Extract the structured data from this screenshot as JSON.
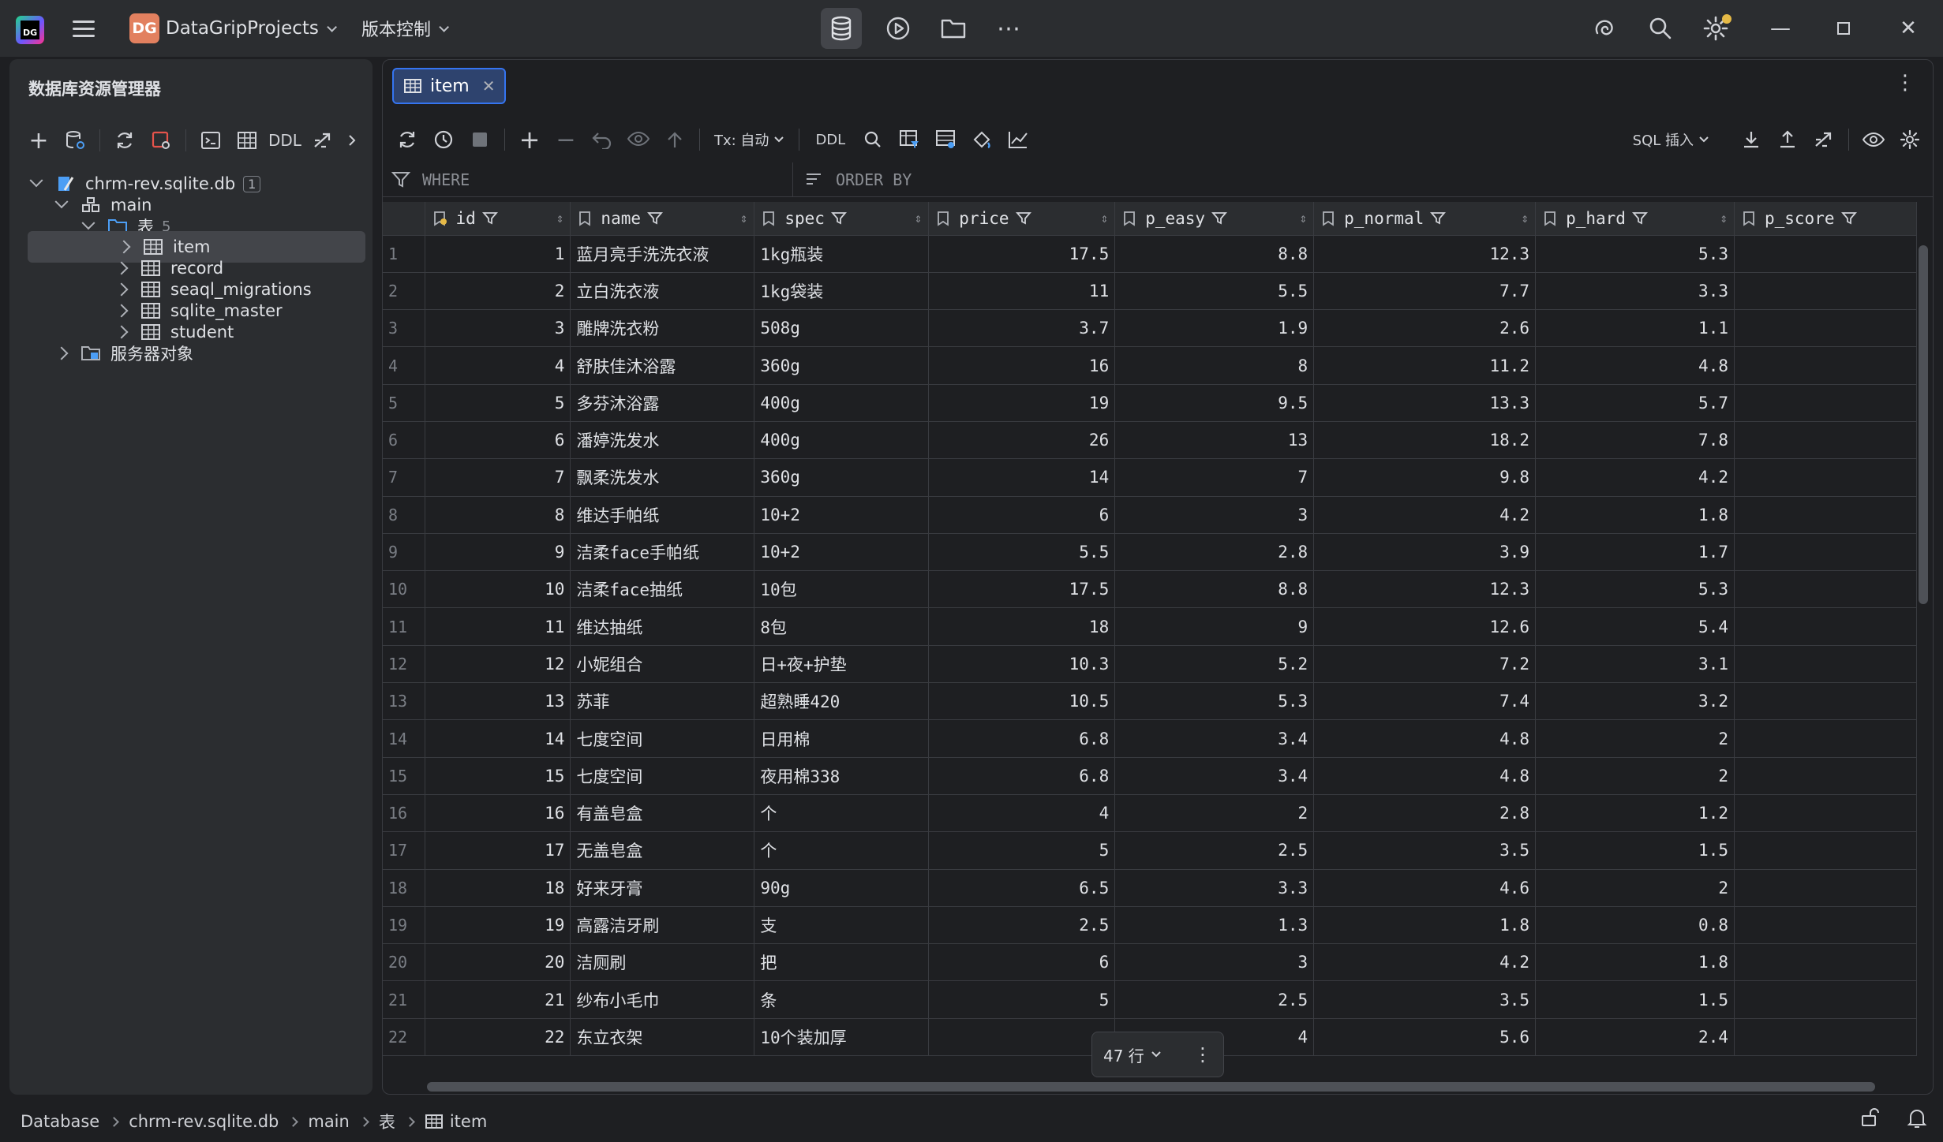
{
  "titlebar": {
    "project_badge": "DG",
    "project_name": "DataGripProjects",
    "vcs_label": "版本控制",
    "logo_text": "DG"
  },
  "left_panel": {
    "title": "数据库资源管理器",
    "toolbar_ddl": "DDL",
    "tree": {
      "db_name": "chrm-rev.sqlite.db",
      "db_badge": "1",
      "schema": "main",
      "tables_folder": "表",
      "tables_count": "5",
      "tables": [
        "item",
        "record",
        "seaql_migrations",
        "sqlite_master",
        "student"
      ],
      "server_objects": "服务器对象"
    }
  },
  "editor": {
    "tab_label": "item",
    "toolbar": {
      "tx_label": "Tx: 自动",
      "ddl_label": "DDL",
      "sql_insert_label": "SQL 插入"
    },
    "filter": {
      "where_label": "WHERE",
      "order_by_label": "ORDER BY"
    },
    "columns": [
      "id",
      "name",
      "spec",
      "price",
      "p_easy",
      "p_normal",
      "p_hard",
      "p_score"
    ],
    "rows": [
      [
        "1",
        "1",
        "蓝月亮手洗洗衣液",
        "1kg瓶装",
        "17.5",
        "8.8",
        "12.3",
        "5.3",
        ""
      ],
      [
        "2",
        "2",
        "立白洗衣液",
        "1kg袋装",
        "11",
        "5.5",
        "7.7",
        "3.3",
        ""
      ],
      [
        "3",
        "3",
        "雕牌洗衣粉",
        "508g",
        "3.7",
        "1.9",
        "2.6",
        "1.1",
        ""
      ],
      [
        "4",
        "4",
        "舒肤佳沐浴露",
        "360g",
        "16",
        "8",
        "11.2",
        "4.8",
        ""
      ],
      [
        "5",
        "5",
        "多芬沐浴露",
        "400g",
        "19",
        "9.5",
        "13.3",
        "5.7",
        ""
      ],
      [
        "6",
        "6",
        "潘婷洗发水",
        "400g",
        "26",
        "13",
        "18.2",
        "7.8",
        ""
      ],
      [
        "7",
        "7",
        "飘柔洗发水",
        "360g",
        "14",
        "7",
        "9.8",
        "4.2",
        ""
      ],
      [
        "8",
        "8",
        "维达手帕纸",
        "10+2",
        "6",
        "3",
        "4.2",
        "1.8",
        ""
      ],
      [
        "9",
        "9",
        "洁柔face手帕纸",
        "10+2",
        "5.5",
        "2.8",
        "3.9",
        "1.7",
        ""
      ],
      [
        "10",
        "10",
        "洁柔face抽纸",
        "10包",
        "17.5",
        "8.8",
        "12.3",
        "5.3",
        ""
      ],
      [
        "11",
        "11",
        "维达抽纸",
        "8包",
        "18",
        "9",
        "12.6",
        "5.4",
        ""
      ],
      [
        "12",
        "12",
        "小妮组合",
        "日+夜+护垫",
        "10.3",
        "5.2",
        "7.2",
        "3.1",
        ""
      ],
      [
        "13",
        "13",
        "苏菲",
        "超熟睡420",
        "10.5",
        "5.3",
        "7.4",
        "3.2",
        ""
      ],
      [
        "14",
        "14",
        "七度空间",
        "日用棉",
        "6.8",
        "3.4",
        "4.8",
        "2",
        ""
      ],
      [
        "15",
        "15",
        "七度空间",
        "夜用棉338",
        "6.8",
        "3.4",
        "4.8",
        "2",
        ""
      ],
      [
        "16",
        "16",
        "有盖皂盒",
        "个",
        "4",
        "2",
        "2.8",
        "1.2",
        ""
      ],
      [
        "17",
        "17",
        "无盖皂盒",
        "个",
        "5",
        "2.5",
        "3.5",
        "1.5",
        ""
      ],
      [
        "18",
        "18",
        "好来牙膏",
        "90g",
        "6.5",
        "3.3",
        "4.6",
        "2",
        ""
      ],
      [
        "19",
        "19",
        "高露洁牙刷",
        "支",
        "2.5",
        "1.3",
        "1.8",
        "0.8",
        ""
      ],
      [
        "20",
        "20",
        "洁厕刷",
        "把",
        "6",
        "3",
        "4.2",
        "1.8",
        ""
      ],
      [
        "21",
        "21",
        "纱布小毛巾",
        "条",
        "5",
        "2.5",
        "3.5",
        "1.5",
        ""
      ],
      [
        "22",
        "22",
        "东立衣架",
        "10个装加厚",
        "",
        "4",
        "5.6",
        "2.4",
        ""
      ]
    ],
    "row_count_label": "47 行"
  },
  "statusbar": {
    "breadcrumbs": [
      "Database",
      "chrm-rev.sqlite.db",
      "main",
      "表",
      "item"
    ]
  }
}
